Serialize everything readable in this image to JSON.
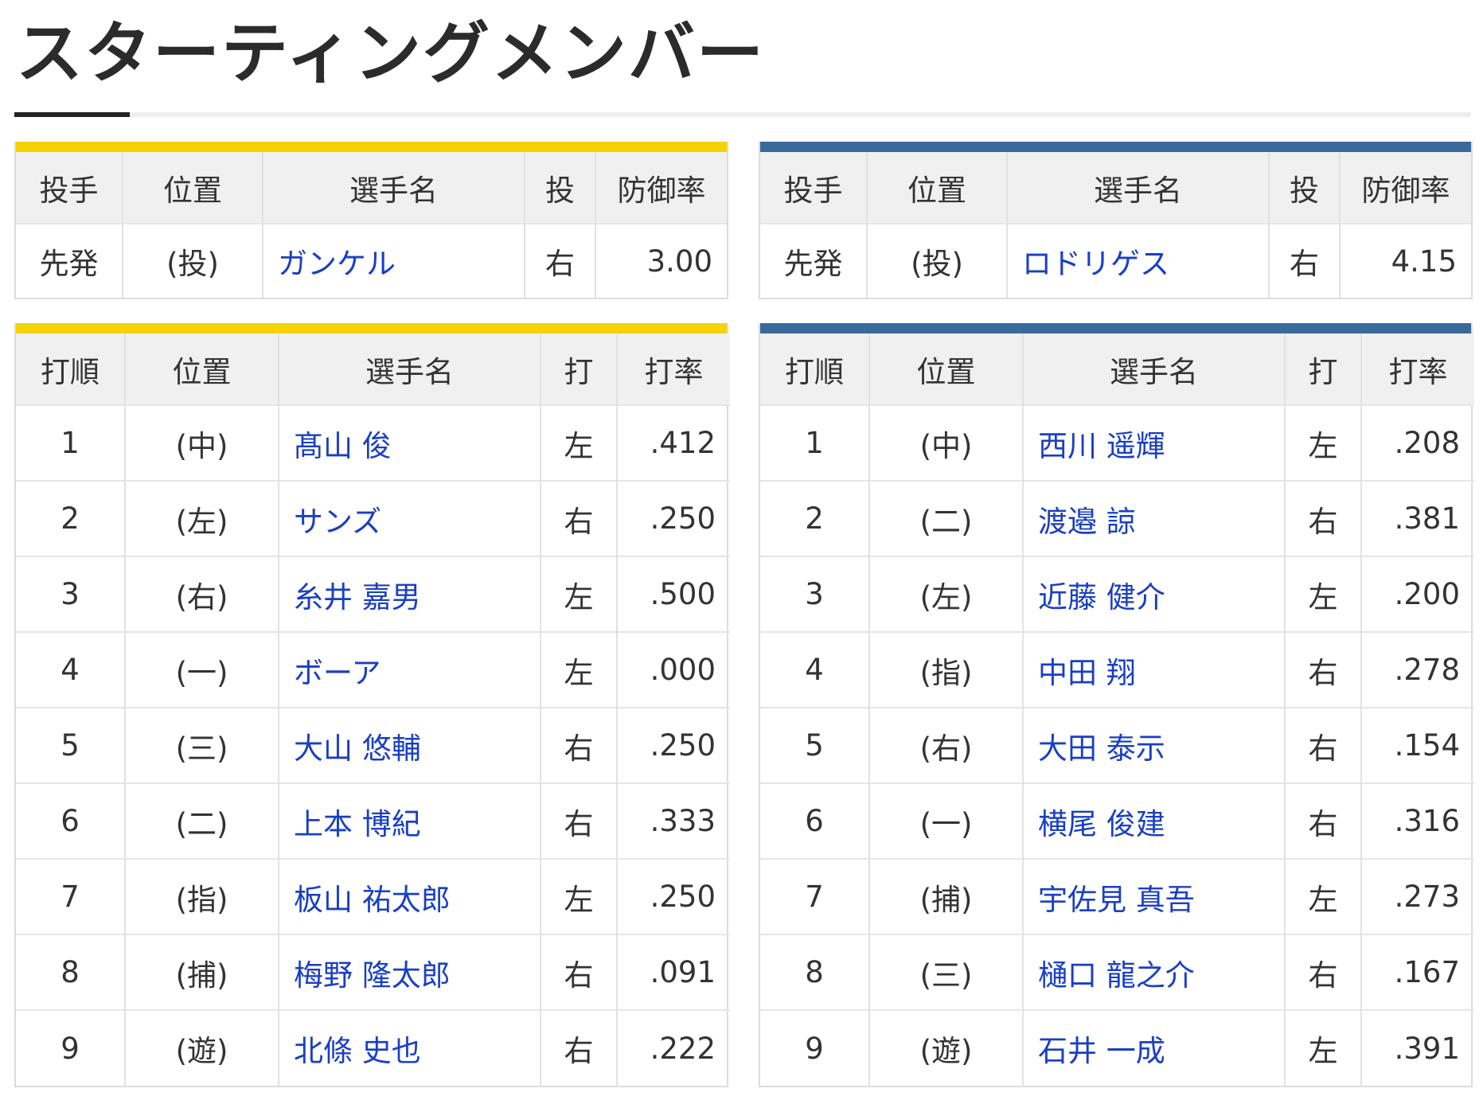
{
  "page_title": "スターティングメンバー",
  "colors": {
    "home_accent": "#f5d200",
    "away_accent": "#3a6a9a",
    "name_link": "#1a3fc4"
  },
  "pitcher_headers": [
    "投手",
    "位置",
    "選手名",
    "投",
    "防御率"
  ],
  "batter_headers": [
    "打順",
    "位置",
    "選手名",
    "打",
    "打率"
  ],
  "home": {
    "pitcher": {
      "role": "先発",
      "pos": "(投)",
      "name": "ガンケル",
      "hand": "右",
      "era": "3.00"
    },
    "lineup": [
      {
        "order": "1",
        "pos": "(中)",
        "name": "髙山 俊",
        "hand": "左",
        "avg": ".412"
      },
      {
        "order": "2",
        "pos": "(左)",
        "name": "サンズ",
        "hand": "右",
        "avg": ".250"
      },
      {
        "order": "3",
        "pos": "(右)",
        "name": "糸井 嘉男",
        "hand": "左",
        "avg": ".500"
      },
      {
        "order": "4",
        "pos": "(一)",
        "name": "ボーア",
        "hand": "左",
        "avg": ".000"
      },
      {
        "order": "5",
        "pos": "(三)",
        "name": "大山 悠輔",
        "hand": "右",
        "avg": ".250"
      },
      {
        "order": "6",
        "pos": "(二)",
        "name": "上本 博紀",
        "hand": "右",
        "avg": ".333"
      },
      {
        "order": "7",
        "pos": "(指)",
        "name": "板山 祐太郎",
        "hand": "左",
        "avg": ".250"
      },
      {
        "order": "8",
        "pos": "(捕)",
        "name": "梅野 隆太郎",
        "hand": "右",
        "avg": ".091"
      },
      {
        "order": "9",
        "pos": "(遊)",
        "name": "北條 史也",
        "hand": "右",
        "avg": ".222"
      }
    ]
  },
  "away": {
    "pitcher": {
      "role": "先発",
      "pos": "(投)",
      "name": "ロドリゲス",
      "hand": "右",
      "era": "4.15"
    },
    "lineup": [
      {
        "order": "1",
        "pos": "(中)",
        "name": "西川 遥輝",
        "hand": "左",
        "avg": ".208"
      },
      {
        "order": "2",
        "pos": "(二)",
        "name": "渡邉 諒",
        "hand": "右",
        "avg": ".381"
      },
      {
        "order": "3",
        "pos": "(左)",
        "name": "近藤 健介",
        "hand": "左",
        "avg": ".200"
      },
      {
        "order": "4",
        "pos": "(指)",
        "name": "中田 翔",
        "hand": "右",
        "avg": ".278"
      },
      {
        "order": "5",
        "pos": "(右)",
        "name": "大田 泰示",
        "hand": "右",
        "avg": ".154"
      },
      {
        "order": "6",
        "pos": "(一)",
        "name": "横尾 俊建",
        "hand": "右",
        "avg": ".316"
      },
      {
        "order": "7",
        "pos": "(捕)",
        "name": "宇佐見 真吾",
        "hand": "左",
        "avg": ".273"
      },
      {
        "order": "8",
        "pos": "(三)",
        "name": "樋口 龍之介",
        "hand": "右",
        "avg": ".167"
      },
      {
        "order": "9",
        "pos": "(遊)",
        "name": "石井 一成",
        "hand": "左",
        "avg": ".391"
      }
    ]
  }
}
